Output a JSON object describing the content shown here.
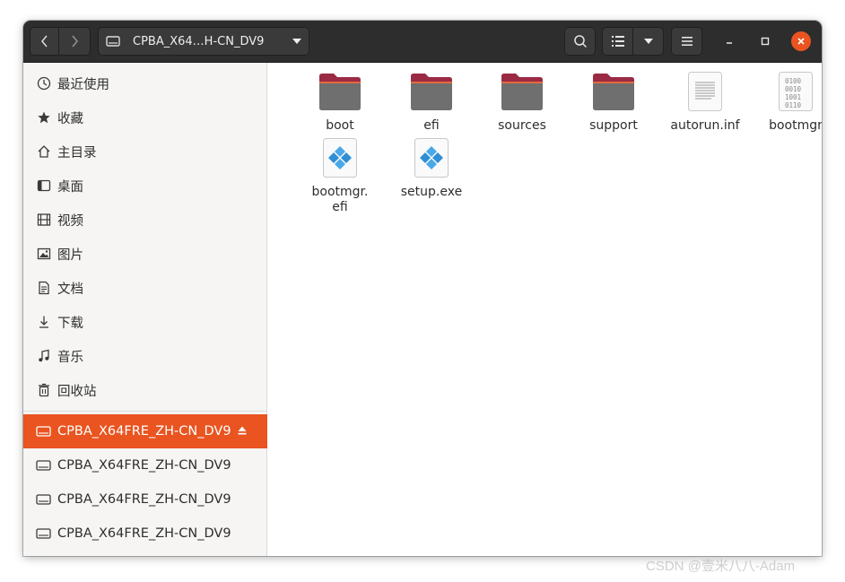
{
  "header": {
    "path_label": "CPBA_X64…H-CN_DV9"
  },
  "sidebar": {
    "places": [
      {
        "label": "最近使用",
        "icon": "clock-icon"
      },
      {
        "label": "收藏",
        "icon": "star-icon"
      },
      {
        "label": "主目录",
        "icon": "home-icon"
      },
      {
        "label": "桌面",
        "icon": "desktop-icon"
      },
      {
        "label": "视频",
        "icon": "video-icon"
      },
      {
        "label": "图片",
        "icon": "picture-icon"
      },
      {
        "label": "文档",
        "icon": "document-icon"
      },
      {
        "label": "下载",
        "icon": "download-icon"
      },
      {
        "label": "音乐",
        "icon": "music-icon"
      },
      {
        "label": "回收站",
        "icon": "trash-icon"
      }
    ],
    "devices": [
      {
        "label": "CPBA_X64FRE_ZH-CN_DV9",
        "icon": "drive-icon",
        "active": true
      },
      {
        "label": "CPBA_X64FRE_ZH-CN_DV9",
        "icon": "drive-icon"
      },
      {
        "label": "CPBA_X64FRE_ZH-CN_DV9",
        "icon": "drive-icon"
      },
      {
        "label": "CPBA_X64FRE_ZH-CN_DV9",
        "icon": "drive-icon"
      }
    ]
  },
  "files": [
    {
      "name": "boot",
      "type": "folder"
    },
    {
      "name": "efi",
      "type": "folder"
    },
    {
      "name": "sources",
      "type": "folder"
    },
    {
      "name": "support",
      "type": "folder"
    },
    {
      "name": "autorun.inf",
      "type": "text"
    },
    {
      "name": "bootmgr",
      "type": "binary"
    },
    {
      "name": "bootmgr.\nefi",
      "type": "executable"
    },
    {
      "name": "setup.exe",
      "type": "executable"
    }
  ],
  "binary_icon_text": [
    "0100",
    "0010",
    "1001",
    "0110"
  ],
  "watermark": "CSDN @壹米八八-Adam",
  "colors": {
    "accent": "#e95420",
    "headerbar": "#2d2d2d",
    "folder_top": "#9b2a44",
    "folder_body": "#6a6a6a",
    "exe_blue": "#3d9fe0"
  }
}
